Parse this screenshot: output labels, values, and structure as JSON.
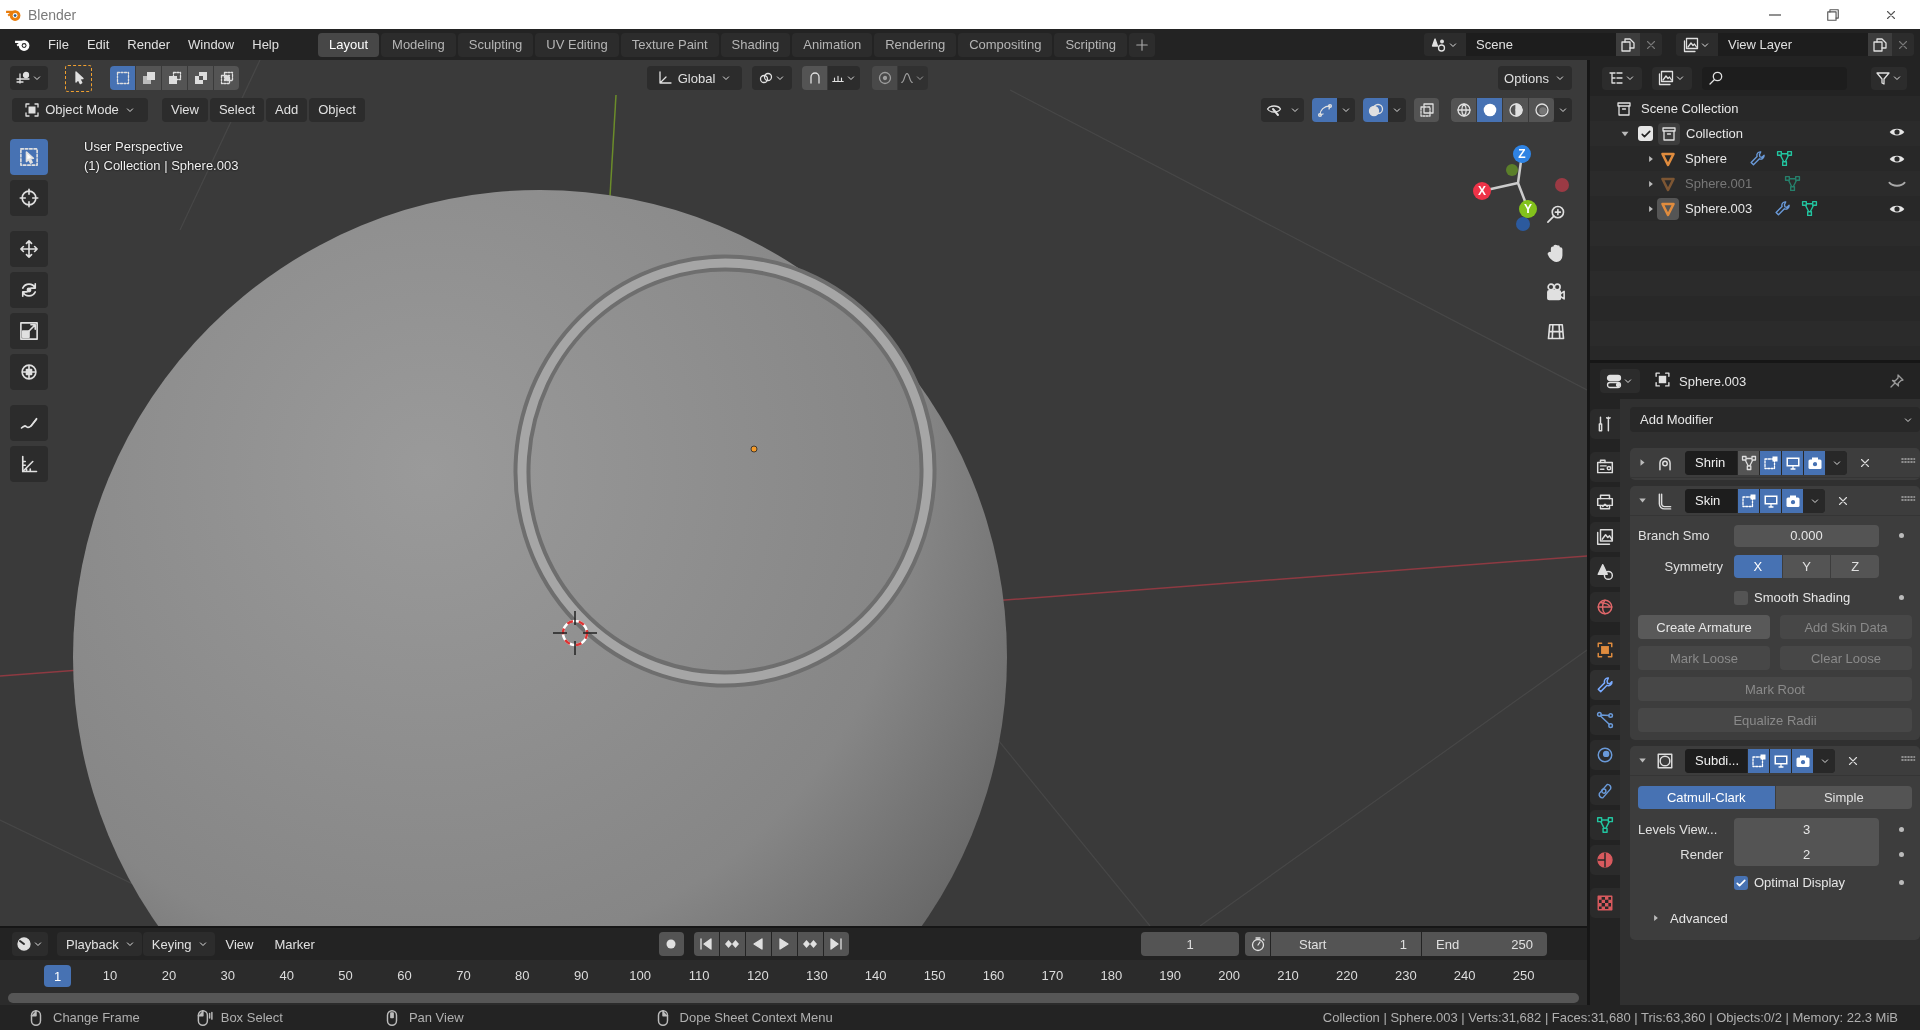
{
  "window": {
    "title": "Blender"
  },
  "menu": [
    "File",
    "Edit",
    "Render",
    "Window",
    "Help"
  ],
  "workspaces": [
    {
      "label": "Layout",
      "selected": true
    },
    {
      "label": "Modeling",
      "selected": false
    },
    {
      "label": "Sculpting",
      "selected": false
    },
    {
      "label": "UV Editing",
      "selected": false
    },
    {
      "label": "Texture Paint",
      "selected": false
    },
    {
      "label": "Shading",
      "selected": false
    },
    {
      "label": "Animation",
      "selected": false
    },
    {
      "label": "Rendering",
      "selected": false
    },
    {
      "label": "Compositing",
      "selected": false
    },
    {
      "label": "Scripting",
      "selected": false
    }
  ],
  "scene": "Scene",
  "view_layer": "View Layer",
  "viewport": {
    "orientation": "Global",
    "options": "Options",
    "mode": "Object Mode",
    "menus": [
      "View",
      "Select",
      "Add",
      "Object"
    ],
    "select_modes": [
      {
        "kind": "set",
        "selected": true
      },
      {
        "kind": "extend",
        "selected": false
      },
      {
        "kind": "subtract",
        "selected": false
      },
      {
        "kind": "difference",
        "selected": false
      },
      {
        "kind": "intersect",
        "selected": false
      }
    ],
    "toggles": [
      {
        "kind": "gizmos",
        "on": true
      },
      {
        "kind": "overlays",
        "on": true
      },
      {
        "kind": "xray",
        "on": false
      }
    ],
    "shading": [
      {
        "kind": "wireframe",
        "selected": false
      },
      {
        "kind": "solid",
        "selected": true
      },
      {
        "kind": "material",
        "selected": false
      },
      {
        "kind": "rendered",
        "selected": false
      }
    ],
    "tools": [
      {
        "kind": "select",
        "selected": true
      },
      {
        "kind": "cursor",
        "selected": false
      },
      {
        "kind": "move",
        "selected": false
      },
      {
        "kind": "rotate",
        "selected": false
      },
      {
        "kind": "scale",
        "selected": false
      },
      {
        "kind": "transform",
        "selected": false
      },
      {
        "kind": "annotate",
        "selected": false
      },
      {
        "kind": "measure",
        "selected": false
      }
    ],
    "info": [
      "User Perspective",
      "(1) Collection | Sphere.003"
    ],
    "axes": [
      "X",
      "Y",
      "Z"
    ]
  },
  "timeline": {
    "menus": [
      {
        "label": "Playback",
        "dropdown": true
      },
      {
        "label": "Keying",
        "dropdown": true
      },
      {
        "label": "View",
        "dropdown": false
      },
      {
        "label": "Marker",
        "dropdown": false
      }
    ],
    "current_frame": "1",
    "start_label": "Start",
    "start": "1",
    "end_label": "End",
    "end": "250",
    "playhead": "1",
    "ruler": [
      "10",
      "20",
      "30",
      "40",
      "50",
      "60",
      "70",
      "80",
      "90",
      "100",
      "110",
      "120",
      "130",
      "140",
      "150",
      "160",
      "170",
      "180",
      "190",
      "200",
      "210",
      "220",
      "230",
      "240",
      "250"
    ]
  },
  "status_bar": {
    "hints": [
      {
        "kind": "left",
        "label": "Change Frame"
      },
      {
        "kind": "drag",
        "label": "Box Select"
      },
      {
        "kind": "middle",
        "label": "Pan View"
      },
      {
        "kind": "right",
        "label": "Dope Sheet Context Menu"
      }
    ],
    "stats": "Collection | Sphere.003 | Verts:31,682 | Faces:31,680 | Tris:63,360 | Objects:0/2 | Memory: 22.3 MiB"
  },
  "outliner": {
    "root": "Scene Collection",
    "collections": [
      {
        "label": "Collection",
        "checked": true,
        "expanded": true,
        "children": [
          {
            "label": "Sphere",
            "visible": true,
            "selected": false,
            "expanded": false,
            "modifiers": true
          },
          {
            "label": "Sphere.001",
            "visible": false,
            "selected": false,
            "expanded": false,
            "modifiers": false
          },
          {
            "label": "Sphere.003",
            "visible": true,
            "selected": true,
            "expanded": false,
            "modifiers": true
          }
        ]
      }
    ]
  },
  "properties": {
    "object": "Sphere.003",
    "add_modifier": "Add Modifier",
    "tabs": [
      {
        "kind": "tool",
        "selected": false
      },
      {
        "kind": "render",
        "selected": false
      },
      {
        "kind": "output",
        "selected": false
      },
      {
        "kind": "view_layer",
        "selected": false
      },
      {
        "kind": "scene",
        "selected": false
      },
      {
        "kind": "world",
        "selected": false
      },
      {
        "kind": "object",
        "selected": false
      },
      {
        "kind": "modifiers",
        "selected": true
      },
      {
        "kind": "particles",
        "selected": false
      },
      {
        "kind": "physics",
        "selected": false
      },
      {
        "kind": "constraints",
        "selected": false
      },
      {
        "kind": "data",
        "selected": false
      },
      {
        "kind": "material",
        "selected": false
      },
      {
        "kind": "texture",
        "selected": false
      }
    ],
    "modifiers": [
      {
        "kind": "shrinkwrap",
        "name": "Shrin",
        "expanded": false
      },
      {
        "kind": "skin",
        "name": "Skin",
        "expanded": true,
        "branch_smoothing": {
          "label": "Branch Smo",
          "value": "0.000"
        },
        "symmetry": {
          "label": "Symmetry",
          "axes": [
            {
              "label": "X",
              "selected": true
            },
            {
              "label": "Y",
              "selected": false
            },
            {
              "label": "Z",
              "selected": false
            }
          ]
        },
        "smooth_shading": {
          "label": "Smooth Shading",
          "checked": false
        },
        "buttons": [
          {
            "label": "Create Armature",
            "disabled": false,
            "kind": "half"
          },
          {
            "label": "Add Skin Data",
            "disabled": true,
            "kind": "half"
          },
          {
            "label": "Mark Loose",
            "disabled": true,
            "kind": "half"
          },
          {
            "label": "Clear Loose",
            "disabled": true,
            "kind": "half"
          },
          {
            "label": "Mark Root",
            "disabled": true,
            "kind": "full"
          },
          {
            "label": "Equalize Radii",
            "disabled": true,
            "kind": "full"
          }
        ]
      },
      {
        "kind": "subdivision",
        "name": "Subdi...",
        "expanded": true,
        "types": [
          {
            "label": "Catmull-Clark",
            "selected": true
          },
          {
            "label": "Simple",
            "selected": false
          }
        ],
        "levels": [
          {
            "label": "Levels View...",
            "value": "3"
          },
          {
            "label": "Render",
            "value": "2"
          }
        ],
        "optimal_display": {
          "label": "Optimal Display",
          "checked": true
        },
        "advanced": {
          "label": "Advanced",
          "expanded": false
        }
      }
    ]
  }
}
